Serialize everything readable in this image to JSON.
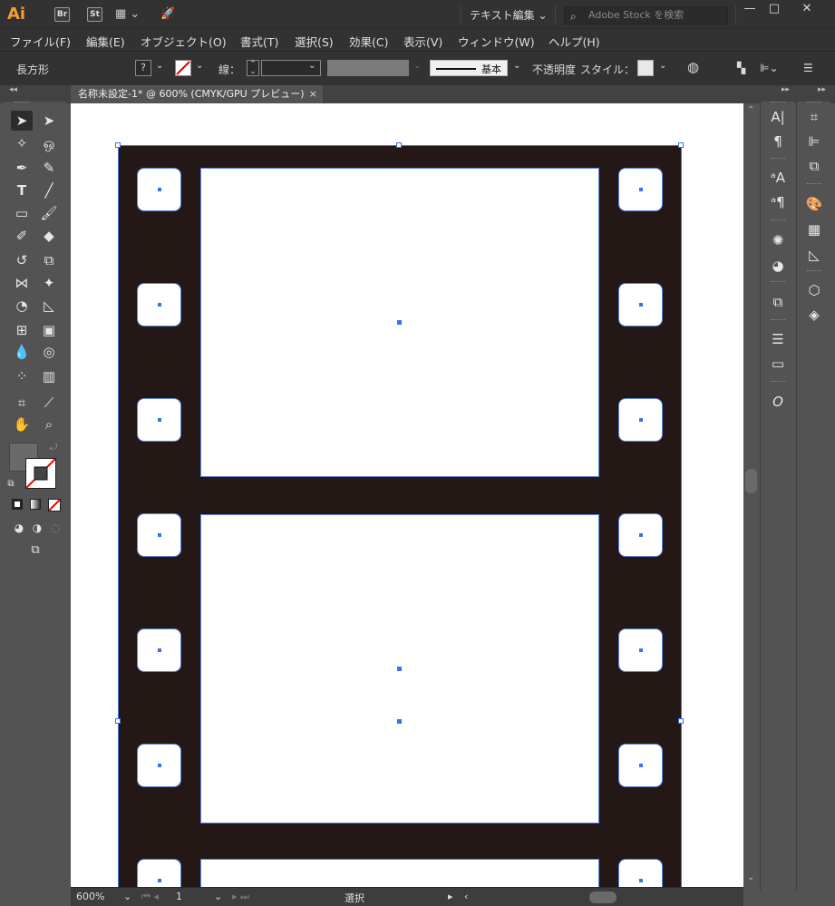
{
  "app": {
    "logo": "Ai",
    "bridge_badge": "Br",
    "stock_badge": "St",
    "workspace": "テキスト編集",
    "search_placeholder": "Adobe Stock を検索"
  },
  "menu": [
    "ファイル(F)",
    "編集(E)",
    "オブジェクト(O)",
    "書式(T)",
    "選択(S)",
    "効果(C)",
    "表示(V)",
    "ウィンドウ(W)",
    "ヘルプ(H)"
  ],
  "control_bar": {
    "object_type": "長方形",
    "fill_value": "?",
    "stroke_label": "線：",
    "stroke_profile": "基本",
    "opacity_label": "不透明度",
    "style_label": "スタイル："
  },
  "document": {
    "tab_title": "名称未設定-1* @ 600% (CMYK/GPU プレビュー)",
    "close": "×"
  },
  "status": {
    "zoom": "600%",
    "artboard": "1",
    "mode": "選択"
  },
  "tools": [
    "selection-tool",
    "direct-selection-tool",
    "magic-wand-tool",
    "lasso-tool",
    "pen-tool",
    "curvature-tool",
    "type-tool",
    "line-tool",
    "rectangle-tool",
    "paintbrush-tool",
    "shaper-tool",
    "eraser-tool",
    "rotate-tool",
    "scale-tool",
    "width-tool",
    "puppet-warp-tool",
    "shape-builder-tool",
    "perspective-grid-tool",
    "mesh-tool",
    "gradient-tool",
    "eyedropper-tool",
    "blend-tool",
    "symbol-sprayer-tool",
    "column-graph-tool",
    "artboard-tool",
    "slice-tool",
    "hand-tool",
    "zoom-tool"
  ],
  "colors": {
    "film": "#231815",
    "selection": "#3a6ff2",
    "chrome_dark": "#323232",
    "chrome_mid": "#535353"
  }
}
